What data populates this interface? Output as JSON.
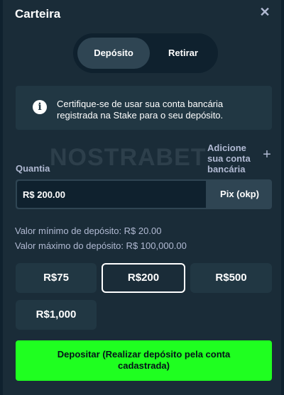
{
  "wallet": {
    "title": "Carteira",
    "close_icon": "close-icon",
    "tabs": [
      {
        "label": "Depósito",
        "active": true
      },
      {
        "label": "Retirar",
        "active": false
      }
    ],
    "info": {
      "icon": "info-icon",
      "text": "Certifique-se de usar sua conta bancária registrada na Stake para o seu depósito."
    },
    "watermark": "NOSTRABET",
    "amount": {
      "label": "Quantia",
      "value": "R$ 200.00",
      "method": "Pix (okp)"
    },
    "add_bank": {
      "label": "Adicione sua conta bancária",
      "icon": "plus-icon"
    },
    "limits": {
      "min": "Valor mínimo de depósito: R$ 20.00",
      "max": "Valor máximo do depósito: R$ 100,000.00"
    },
    "presets": [
      {
        "label": "R$75",
        "selected": false
      },
      {
        "label": "R$200",
        "selected": true
      },
      {
        "label": "R$500",
        "selected": false
      },
      {
        "label": "R$1,000",
        "selected": false
      }
    ],
    "deposit_button": "Depositar (Realizar depósito pela conta cadastrada)"
  },
  "colors": {
    "background": "#1a2c38",
    "panel": "#213743",
    "dark": "#0f212e",
    "input_border": "#2f4553",
    "muted_text": "#b1bad3",
    "accent_green": "#1fff20"
  }
}
